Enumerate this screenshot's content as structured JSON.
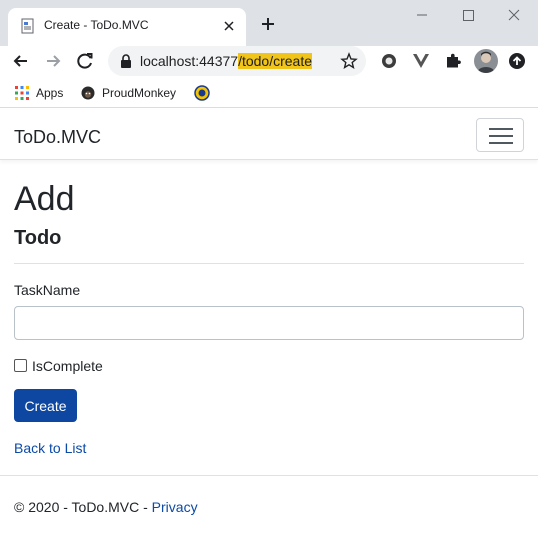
{
  "browser": {
    "tab_title": "Create - ToDo.MVC",
    "url_host": "localhost:44377",
    "url_path": "/todo/create",
    "bookmarks": [
      {
        "label": "Apps",
        "icon": "apps-grid-icon"
      },
      {
        "label": "ProudMonkey",
        "icon": "monkey-icon"
      },
      {
        "label": "",
        "icon": "extension-bookmark-icon"
      }
    ]
  },
  "navbar": {
    "brand": "ToDo.MVC"
  },
  "main": {
    "heading": "Add",
    "subheading": "Todo",
    "task_label": "TaskName",
    "task_value": "",
    "complete_label": "IsComplete",
    "complete_checked": false,
    "create_button": "Create",
    "back_link": "Back to List"
  },
  "footer": {
    "text": "© 2020 - ToDo.MVC - ",
    "privacy_link": "Privacy"
  },
  "colors": {
    "primary": "#0d47a1",
    "link": "#0b4aa8",
    "url_highlight": "#f0c419",
    "titlebar": "#dee1e6"
  }
}
